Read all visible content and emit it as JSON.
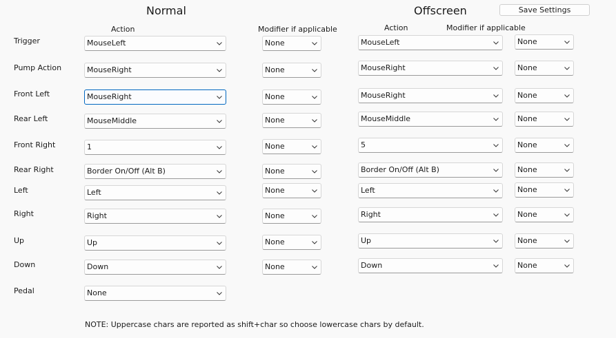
{
  "titles": {
    "normal": "Normal",
    "offscreen": "Offscreen"
  },
  "save_button": "Save Settings",
  "headers": {
    "normal_action": "Action",
    "normal_modifier": "Modifier if applicable",
    "offscreen_action": "Action",
    "offscreen_modifier": "Modifier if applicable"
  },
  "rows": [
    {
      "label": "Trigger",
      "normal_action": "MouseLeft",
      "normal_modifier": "None",
      "offscreen_action": "MouseLeft",
      "offscreen_modifier": "None"
    },
    {
      "label": "Pump Action",
      "normal_action": "MouseRight",
      "normal_modifier": "None",
      "offscreen_action": "MouseRight",
      "offscreen_modifier": "None"
    },
    {
      "label": "Front Left",
      "normal_action": "MouseRight",
      "normal_modifier": "None",
      "offscreen_action": "MouseRight",
      "offscreen_modifier": "None"
    },
    {
      "label": "Rear Left",
      "normal_action": "MouseMiddle",
      "normal_modifier": "None",
      "offscreen_action": "MouseMiddle",
      "offscreen_modifier": "None"
    },
    {
      "label": "Front Right",
      "normal_action": "1",
      "normal_modifier": "None",
      "offscreen_action": "5",
      "offscreen_modifier": "None"
    },
    {
      "label": "Rear Right",
      "normal_action": "Border On/Off (Alt B)",
      "normal_modifier": "None",
      "offscreen_action": "Border On/Off (Alt B)",
      "offscreen_modifier": "None"
    },
    {
      "label": "Left",
      "normal_action": "Left",
      "normal_modifier": "None",
      "offscreen_action": "Left",
      "offscreen_modifier": "None"
    },
    {
      "label": "Right",
      "normal_action": "Right",
      "normal_modifier": "None",
      "offscreen_action": "Right",
      "offscreen_modifier": "None"
    },
    {
      "label": "Up",
      "normal_action": "Up",
      "normal_modifier": "None",
      "offscreen_action": "Up",
      "offscreen_modifier": "None"
    },
    {
      "label": "Down",
      "normal_action": "Down",
      "normal_modifier": "None",
      "offscreen_action": "Down",
      "offscreen_modifier": "None"
    },
    {
      "label": "Pedal",
      "normal_action": "None"
    }
  ],
  "note": "NOTE: Uppercase chars are reported as shift+char so choose lowercase chars by default.",
  "colors": {
    "background": "#f9f9f9",
    "focus_border": "#0067c0"
  },
  "icons": {
    "dropdown": "chevron-down-icon"
  }
}
